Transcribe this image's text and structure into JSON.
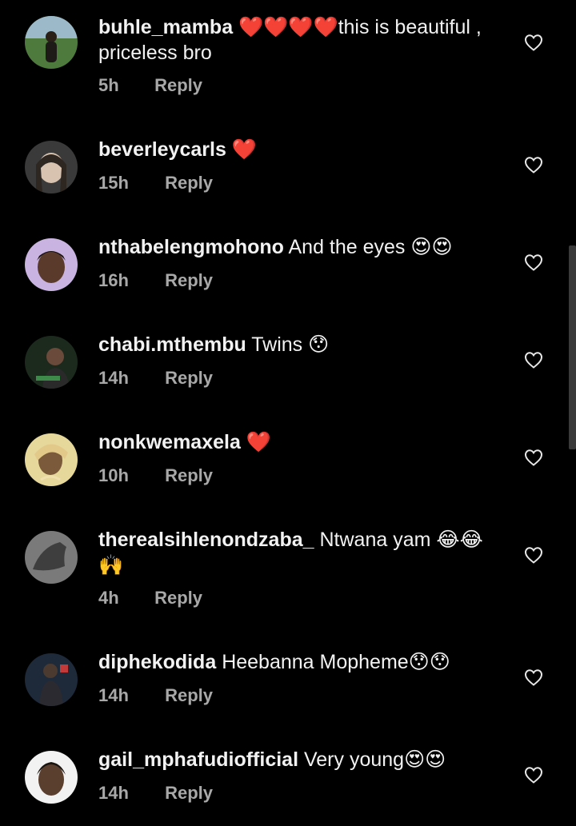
{
  "comments": [
    {
      "username": "buhle_mamba",
      "text": "❤️❤️❤️❤️this is beautiful , priceless bro",
      "time": "5h",
      "reply": "Reply",
      "avatar": {
        "bg": "#4f7a3e",
        "fg": "#2a3f22"
      }
    },
    {
      "username": "beverleycarls",
      "text": "❤️",
      "time": "15h",
      "reply": "Reply",
      "avatar": {
        "bg": "#3a3a3a",
        "fg": "#d8c3b0"
      }
    },
    {
      "username": "nthabelengmohono",
      "text": "And the eyes 😍😍",
      "time": "16h",
      "reply": "Reply",
      "avatar": {
        "bg": "#c9b3e0",
        "fg": "#5a3a2a"
      }
    },
    {
      "username": "chabi.mthembu",
      "text": "Twins 😯",
      "time": "14h",
      "reply": "Reply",
      "avatar": {
        "bg": "#1c2a1e",
        "fg": "#6a4a3a"
      }
    },
    {
      "username": "nonkwemaxela",
      "text": "❤️",
      "time": "10h",
      "reply": "Reply",
      "avatar": {
        "bg": "#e6d89a",
        "fg": "#7a5a3a"
      }
    },
    {
      "username": "therealsihlenondzaba_",
      "text": "Ntwana yam 😂😂 🙌",
      "time": "4h",
      "reply": "Reply",
      "avatar": {
        "bg": "#7a7a7a",
        "fg": "#3e3e3e"
      }
    },
    {
      "username": "diphekodida",
      "text": "Heebanna  Mopheme😯😯",
      "time": "14h",
      "reply": "Reply",
      "avatar": {
        "bg": "#1e2a3a",
        "fg": "#4a3a30"
      }
    },
    {
      "username": "gail_mphafudiofficial",
      "text": "Very young😍😍",
      "time": "14h",
      "reply": "Reply",
      "avatar": {
        "bg": "#f2f2f2",
        "fg": "#5a3e2e"
      }
    }
  ],
  "icons": {
    "like": "heart-outline-icon"
  },
  "colors": {
    "background": "#000000",
    "text": "#f2f2f2",
    "meta": "#a8a8a8"
  }
}
